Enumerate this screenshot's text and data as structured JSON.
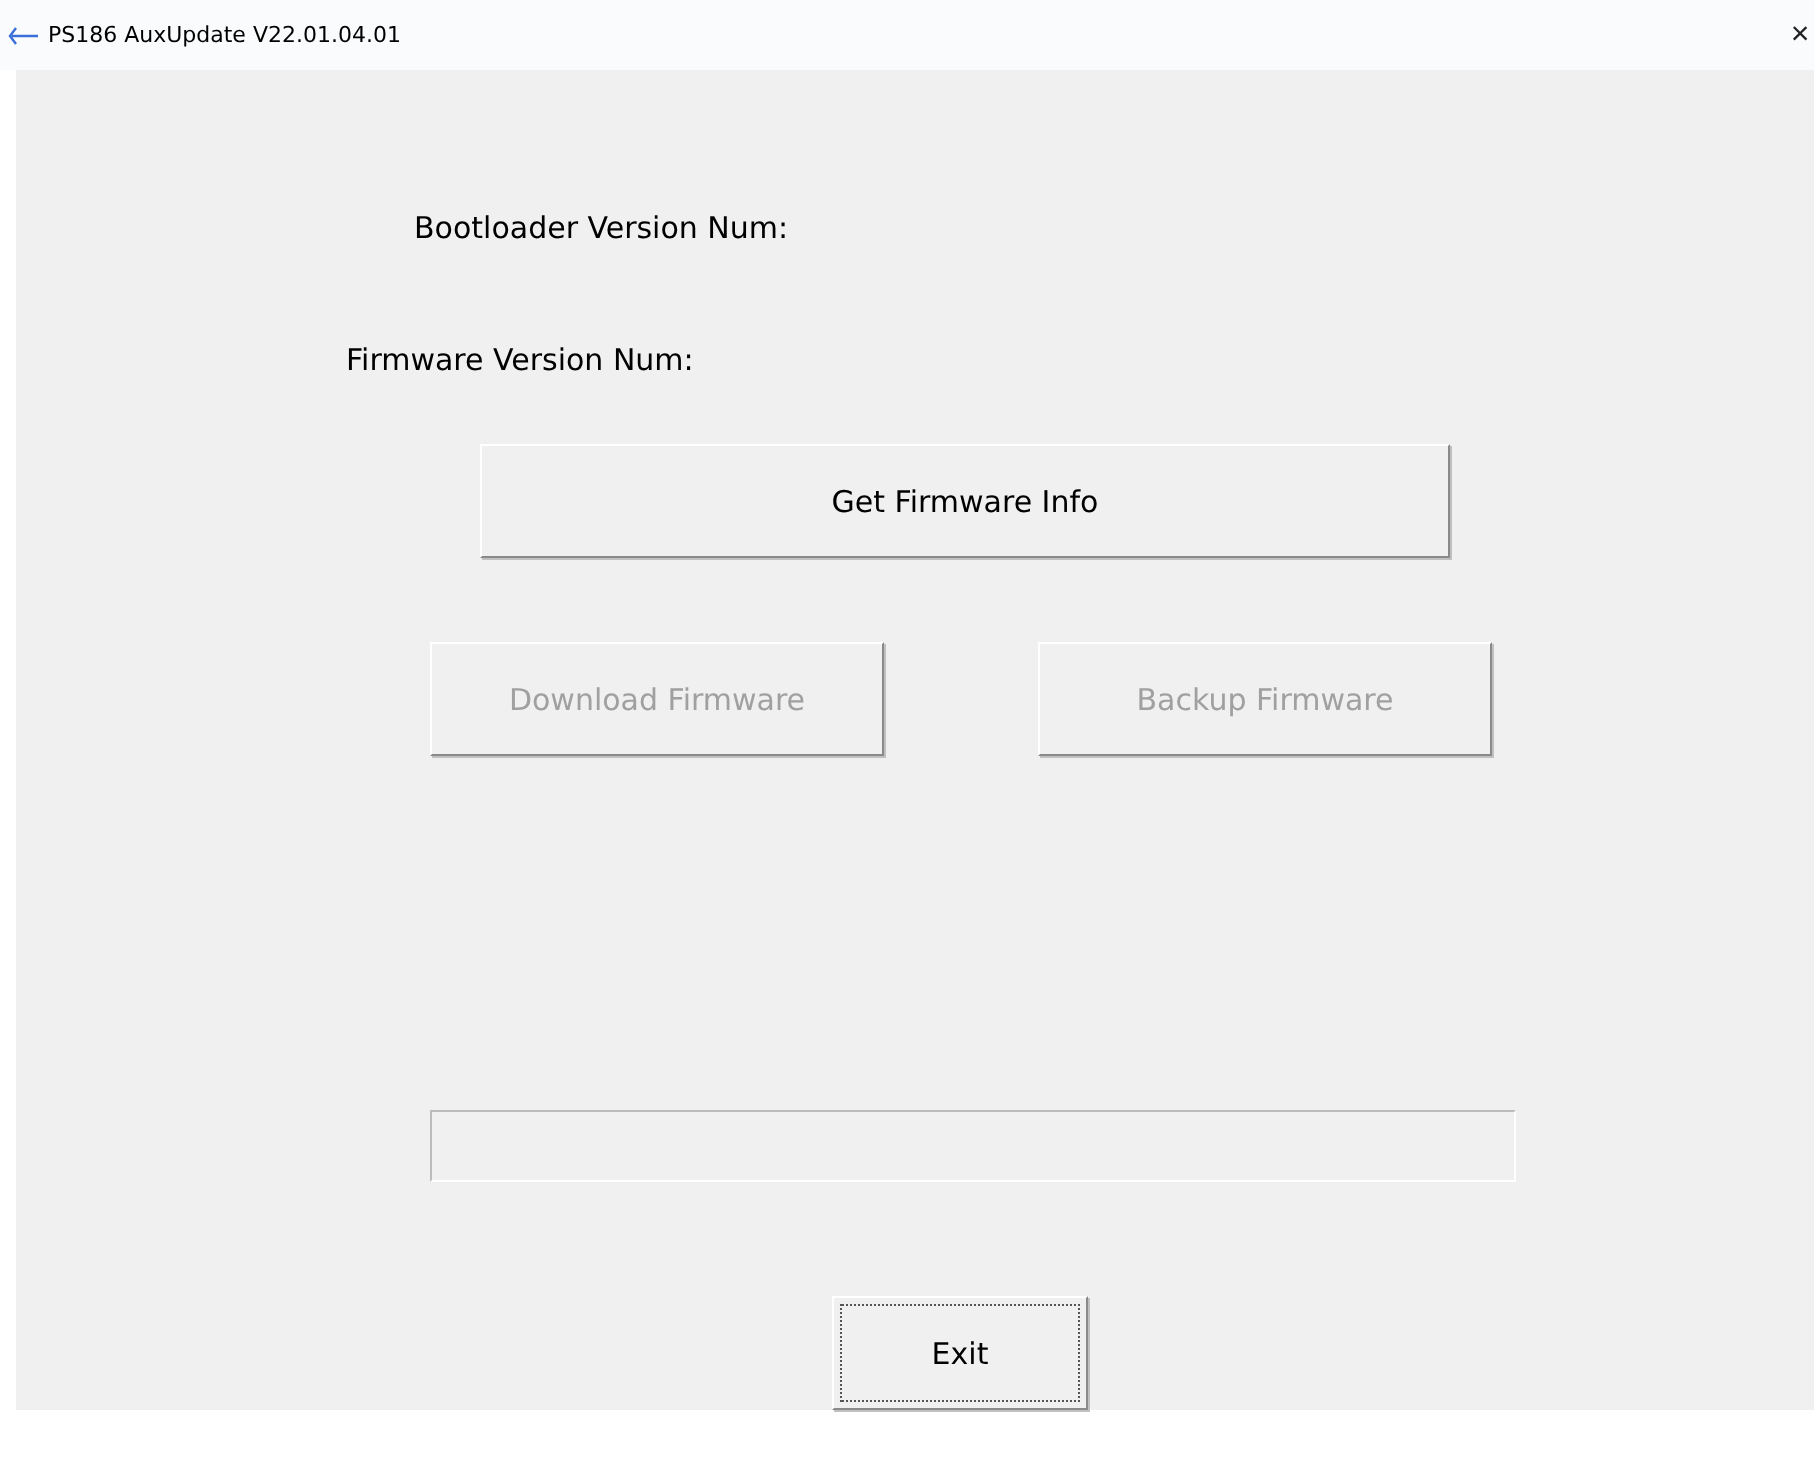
{
  "window": {
    "title": "PS186 AuxUpdate V22.01.04.01",
    "close": "×"
  },
  "labels": [
    "Bootloader Version Num:",
    "Firmware Version Num:"
  ],
  "buttons": [
    {
      "label": "Get Firmware Info",
      "disabled": false
    },
    {
      "label": "Download Firmware",
      "disabled": true
    },
    {
      "label": "Backup Firmware",
      "disabled": true
    }
  ],
  "progress": {
    "level": 0
  },
  "exit": {
    "label": "Exit",
    "focused": true
  }
}
